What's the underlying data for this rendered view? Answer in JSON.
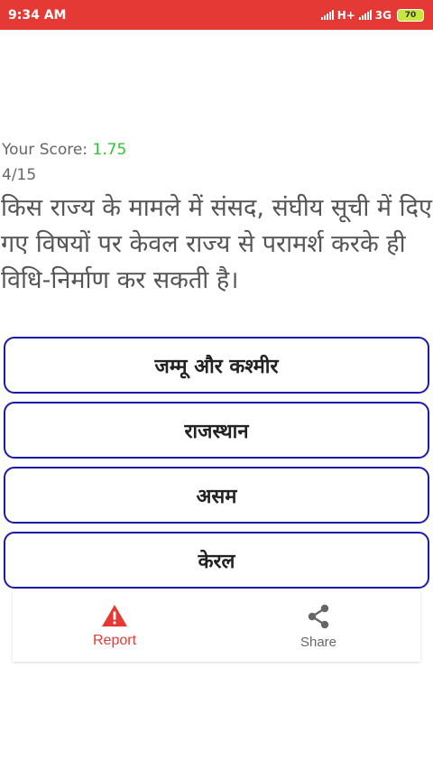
{
  "status_bar": {
    "time": "9:34 AM",
    "network": "H+",
    "network2": "3G",
    "battery": "70"
  },
  "quiz": {
    "score_label": "Your Score: ",
    "score_value": "1.75",
    "progress": "4/15",
    "question": "किस राज्य के मामले में संसद, संघीय सूची में दिए गए विषयों पर केवल राज्य से परामर्श करके ही विधि-निर्माण कर सकती है।",
    "options": [
      "जम्मू और कश्मीर",
      "राजस्थान",
      "असम",
      "केरल"
    ]
  },
  "actions": {
    "report_label": "Report",
    "share_label": "Share",
    "report_icon": "warning-icon",
    "share_icon": "share-icon"
  },
  "colors": {
    "status_bar": "#e53935",
    "score_value": "#2ec92e",
    "option_border": "#1a1aa8",
    "report": "#e53935"
  }
}
